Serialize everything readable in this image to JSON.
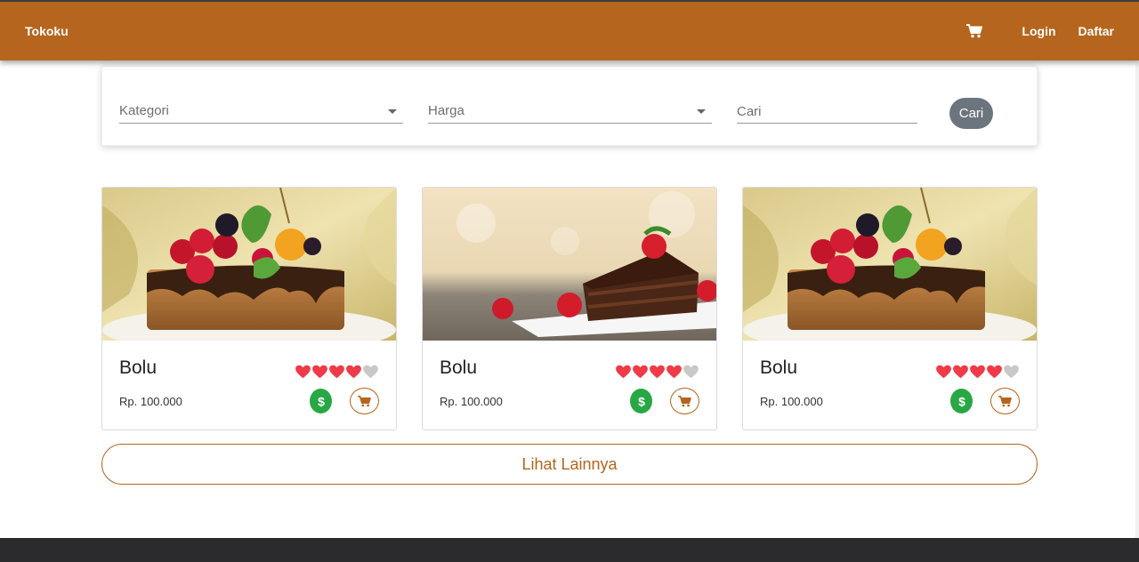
{
  "colors": {
    "brand": "#b5651d",
    "heart_active": "#f03a47",
    "heart_inactive": "#c8c8c8",
    "buy": "#28a745",
    "search_button": "#6c757d",
    "footer": "#2b2b2d"
  },
  "navbar": {
    "brand": "Tokoku",
    "cart_icon": "shopping-cart-icon",
    "login": "Login",
    "register": "Daftar"
  },
  "filters": {
    "category_placeholder": "Kategori",
    "price_placeholder": "Harga",
    "search_placeholder": "Cari",
    "search_button": "Cari"
  },
  "products": [
    {
      "name": "Bolu",
      "price": "Rp. 100.000",
      "rating": 4,
      "rating_max": 5,
      "image": "fruit-cake"
    },
    {
      "name": "Bolu",
      "price": "Rp. 100.000",
      "rating": 4,
      "rating_max": 5,
      "image": "chocolate-cake-slice"
    },
    {
      "name": "Bolu",
      "price": "Rp. 100.000",
      "rating": 4,
      "rating_max": 5,
      "image": "fruit-cake"
    }
  ],
  "more_button": "Lihat Lainnya"
}
